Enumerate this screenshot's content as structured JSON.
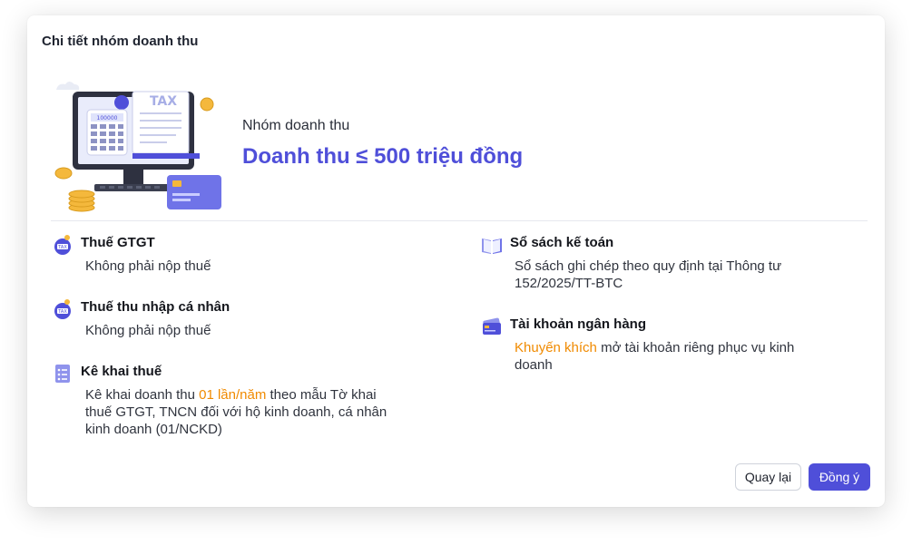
{
  "dialog": {
    "title": "Chi tiết nhóm doanh thu",
    "group_label": "Nhóm doanh thu",
    "group_value": "Doanh thu ≤ 500 triệu đồng",
    "hero_tax_text": "TAX",
    "hero_screen_number": "100000"
  },
  "left_items": [
    {
      "icon": "tax-piggy-icon",
      "title": "Thuế GTGT",
      "desc": "Không phải nộp thuế"
    },
    {
      "icon": "tax-piggy-icon",
      "title": "Thuế thu nhập cá nhân",
      "desc": "Không phải nộp thuế"
    },
    {
      "icon": "checklist-icon",
      "title": "Kê khai thuế",
      "desc_pre": "Kê khai doanh thu ",
      "desc_highlight": "01 lần/năm",
      "desc_line1_post": " theo mẫu Tờ khai",
      "desc_line2": "thuế GTGT, TNCN đối với hộ kinh doanh, cá nhân",
      "desc_line3": "kinh doanh (01/NCKD)"
    }
  ],
  "right_items": [
    {
      "icon": "ledger-book-icon",
      "title": "Sổ sách kế toán",
      "desc_line1": "Sổ sách ghi chép theo quy định tại Thông tư",
      "desc_line2": "152/2025/TT-BTC"
    },
    {
      "icon": "bank-card-icon",
      "title": "Tài khoản ngân hàng",
      "desc_highlight": "Khuyến khích",
      "desc_line1_post": " mở tài khoản riêng phục vụ kinh",
      "desc_line2": "doanh"
    }
  ],
  "buttons": {
    "back_label": "Quay lại",
    "ok_label": "Đồng ý"
  },
  "colors": {
    "accent": "#4f4fd9",
    "highlight": "#f08a00",
    "divider": "#e6e8ee"
  }
}
